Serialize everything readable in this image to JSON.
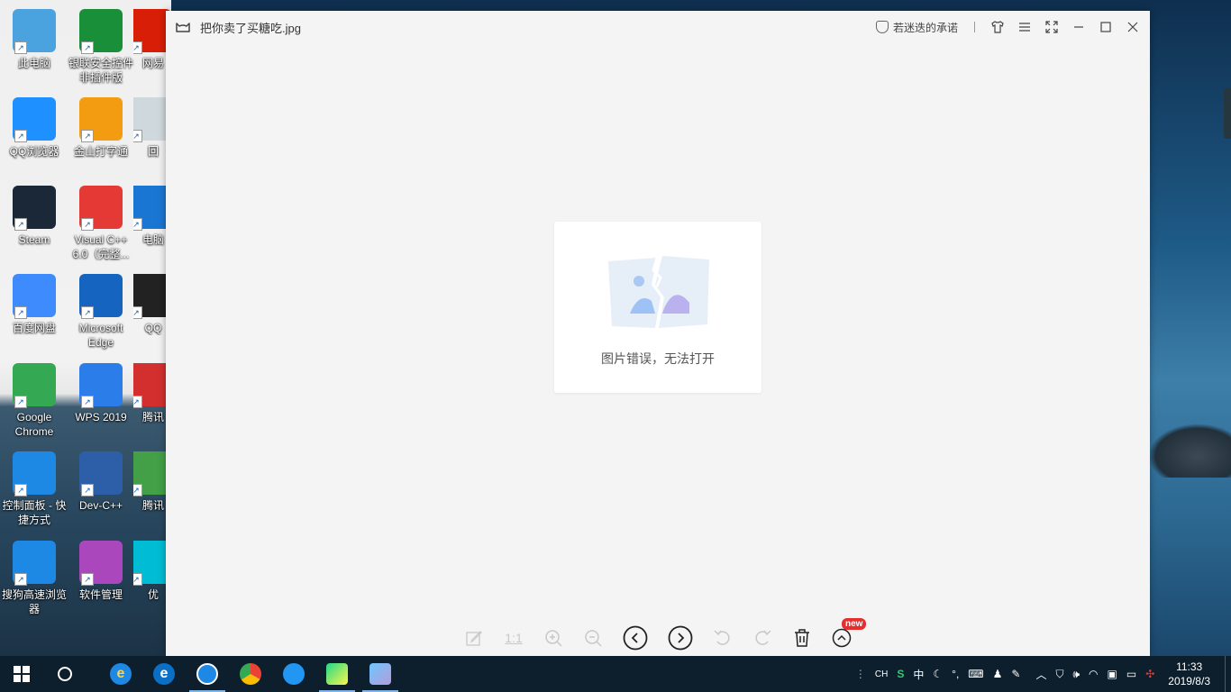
{
  "desktop": {
    "icons": [
      {
        "label": "此电脑",
        "icon": "computer-icon",
        "color": "#4aa3df"
      },
      {
        "label": "银联安全控件非插件版",
        "icon": "shield-icon",
        "color": "#1a8f3a"
      },
      {
        "label": "网易",
        "icon": "netease-icon",
        "color": "#d81e06"
      },
      {
        "label": "QQ浏览器",
        "icon": "qq-browser-icon",
        "color": "#1e90ff"
      },
      {
        "label": "金山打字通",
        "icon": "typing-icon",
        "color": "#f39c12"
      },
      {
        "label": "回",
        "icon": "recycle-bin-icon",
        "color": "#cfd8dc"
      },
      {
        "label": "Steam",
        "icon": "steam-icon",
        "color": "#1b2838"
      },
      {
        "label": "Visual C++ 6.0（完整...",
        "icon": "visual-cpp-icon",
        "color": "#e53935"
      },
      {
        "label": "电脑",
        "icon": "security-icon",
        "color": "#1976d2"
      },
      {
        "label": "百度网盘",
        "icon": "baidu-pan-icon",
        "color": "#3d8bfd"
      },
      {
        "label": "Microsoft Edge",
        "icon": "edge-icon",
        "color": "#1565c0"
      },
      {
        "label": "QQ",
        "icon": "qq-icon",
        "color": "#222222"
      },
      {
        "label": "Google Chrome",
        "icon": "chrome-icon",
        "color": "#34a853"
      },
      {
        "label": "WPS 2019",
        "icon": "wps-icon",
        "color": "#2b7de9"
      },
      {
        "label": "腾讯",
        "icon": "tencent-icon",
        "color": "#d32f2f"
      },
      {
        "label": "控制面板 - 快捷方式",
        "icon": "control-panel-icon",
        "color": "#1e88e5"
      },
      {
        "label": "Dev-C++",
        "icon": "devcpp-icon",
        "color": "#2d5ea8"
      },
      {
        "label": "腾讯",
        "icon": "tencent-video-icon",
        "color": "#43a047"
      },
      {
        "label": "搜狗高速浏览器",
        "icon": "sogou-icon",
        "color": "#1e88e5"
      },
      {
        "label": "软件管理",
        "icon": "software-manager-icon",
        "color": "#ab47bc"
      },
      {
        "label": "优",
        "icon": "youku-icon",
        "color": "#00bcd4"
      }
    ]
  },
  "viewer": {
    "title": "把你卖了买糖吃.jpg",
    "title_icon": "cat-logo-icon",
    "promise_label": "若迷迭的承诺",
    "error_message": "图片错误，无法打开",
    "toolbar": {
      "actual_size_label": "1:1",
      "new_badge": "new"
    }
  },
  "taskbar": {
    "apps": [
      "start-icon",
      "cortana-icon",
      "ie-icon",
      "edge-icon",
      "sogou-icon",
      "chrome-icon",
      "qq-browser-icon",
      "pycharm-icon",
      "photo-viewer-icon"
    ],
    "tray": {
      "lang": "CH",
      "ime_mode": "中",
      "time": "11:33",
      "date": "2019/8/3"
    }
  },
  "colors": {
    "accent": "#7eb4e8",
    "badge": "#e62e2e",
    "taskbar": "#0d1f2d"
  }
}
